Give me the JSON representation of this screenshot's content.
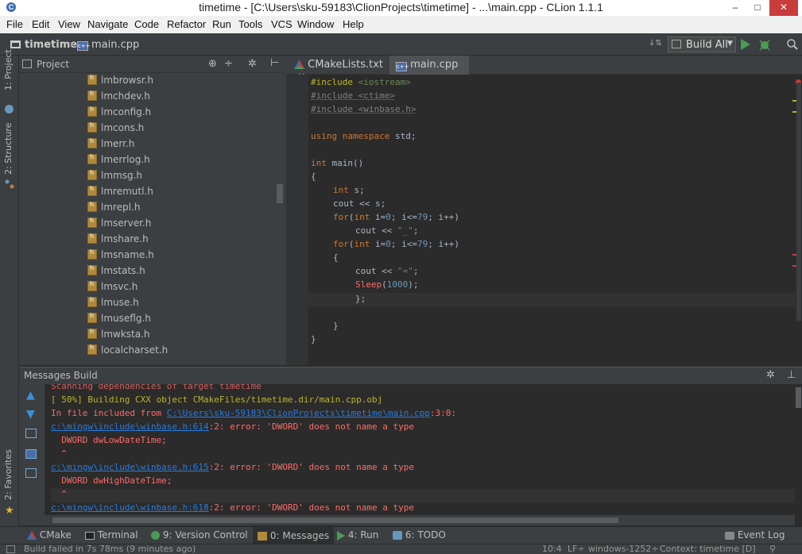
{
  "window": {
    "title": "timetime - [C:\\Users\\sku-59183\\ClionProjects\\timetime] - ...\\main.cpp - CLion 1.1.1",
    "logo_letter": "C",
    "minimize": "–",
    "maximize": "□",
    "close": "✕"
  },
  "menu": [
    "File",
    "Edit",
    "View",
    "Navigate",
    "Code",
    "Refactor",
    "Run",
    "Tools",
    "VCS",
    "Window",
    "Help"
  ],
  "breadcrumb": {
    "project": "timetime",
    "file": "main.cpp"
  },
  "toolbar": {
    "run_config": "Build All"
  },
  "left_tabs": {
    "project": "1: Project",
    "structure": "2: Structure",
    "favorites": "2: Favorites"
  },
  "project_panel": {
    "title": "Project",
    "files": [
      "lmbrowsr.h",
      "lmchdev.h",
      "lmconfig.h",
      "lmcons.h",
      "lmerr.h",
      "lmerrlog.h",
      "lmmsg.h",
      "lmremutl.h",
      "lmrepl.h",
      "lmserver.h",
      "lmshare.h",
      "lmsname.h",
      "lmstats.h",
      "lmsvc.h",
      "lmuse.h",
      "lmuseflg.h",
      "lmwksta.h",
      "localcharset.h"
    ]
  },
  "editor_tabs": [
    {
      "label": "CMakeLists.txt",
      "active": false
    },
    {
      "label": "main.cpp",
      "active": true
    }
  ],
  "code": {
    "l1_kw": "#include",
    "l1_arg": "<iostream>",
    "l2": "#include <ctime>",
    "l3": "#include <winbase.h>",
    "l5_kw": "using namespace",
    "l5_rest": " std;",
    "l7_kw": "int",
    "l7_rest": " main()",
    "l8": "{",
    "l9_kw": "int",
    "l9_rest": " s;",
    "l10": "cout << s;",
    "l11_kw1": "for",
    "l11_a": "(",
    "l11_kw2": "int",
    "l11_b": " i=",
    "l11_n1": "0",
    "l11_c": "; i<=",
    "l11_n2": "79",
    "l11_d": "; i++)",
    "l12_a": "cout << ",
    "l12_str": "\"_\"",
    "l12_b": ";",
    "l13_kw1": "for",
    "l13_a": "(",
    "l13_kw2": "int",
    "l13_b": " i=",
    "l13_n1": "0",
    "l13_c": "; i<=",
    "l13_n2": "79",
    "l13_d": "; i++)",
    "l14": "{",
    "l15_a": "cout << ",
    "l15_str": "\"=\"",
    "l15_b": ";",
    "l16_fn": "Sleep",
    "l16_a": "(",
    "l16_num": "1000",
    "l16_b": ");",
    "l17": "};",
    "l19": "}",
    "l20": "}"
  },
  "messages": {
    "title": "Messages Build",
    "lines": {
      "m1": "Scanning dependencies of target timetime",
      "m2": "[ 50%] Building CXX object CMakeFiles/timetime.dir/main.cpp.obj",
      "m3_a": "In file included from ",
      "m3_link": "C:\\Users\\sku-59183\\ClionProjects\\timetime\\main.cpp",
      "m3_b": ":3:0:",
      "m4_link": "c:\\mingw\\include\\winbase.h:614",
      "m4_b": ":2: error: 'DWORD' does not name a type",
      "m5": "  DWORD dwLowDateTime;",
      "m6": "  ^",
      "m7_link": "c:\\mingw\\include\\winbase.h:615",
      "m7_b": ":2: error: 'DWORD' does not name a type",
      "m8": "  DWORD dwHighDateTime;",
      "m9": "  ^",
      "m10_link": "c:\\mingw\\include\\winbase.h:618",
      "m10_b": ":2: error: 'DWORD' does not name a type"
    }
  },
  "tool_windows": {
    "cmake": "CMake",
    "terminal": "Terminal",
    "vcs": "9: Version Control",
    "messages": "0: Messages",
    "run": "4: Run",
    "todo": "6: TODO",
    "event_log": "Event Log"
  },
  "status": {
    "message": "Build failed in 7s 78ms (9 minutes ago)",
    "position": "10:4",
    "line_sep": "LF÷",
    "encoding": "windows-1252÷",
    "context": "Context: timetime [D]"
  },
  "colors": {
    "error": "#ff6b68",
    "link": "#287bde",
    "keyword": "#cc7832",
    "string": "#6a8759",
    "number": "#6897bb",
    "preproc": "#bbb529"
  }
}
